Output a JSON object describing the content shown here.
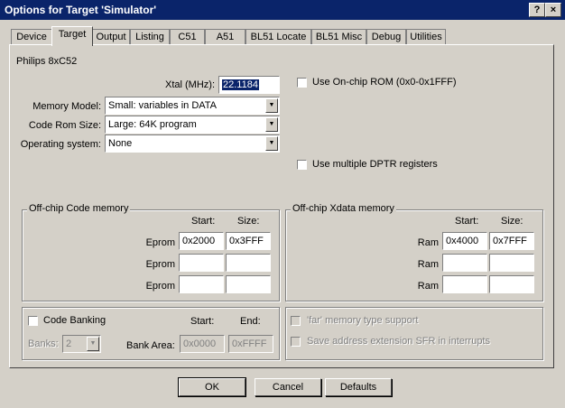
{
  "window": {
    "title": "Options for Target 'Simulator'",
    "help": "?",
    "close": "×"
  },
  "tabs": [
    "Device",
    "Target",
    "Output",
    "Listing",
    "C51",
    "A51",
    "BL51 Locate",
    "BL51 Misc",
    "Debug",
    "Utilities"
  ],
  "device_name": "Philips 8xC52",
  "xtal": {
    "label": "Xtal (MHz):",
    "value": "22.1184"
  },
  "memory_model": {
    "label": "Memory Model:",
    "value": "Small: variables in DATA"
  },
  "code_rom_size": {
    "label": "Code Rom Size:",
    "value": "Large: 64K program"
  },
  "operating_system": {
    "label": "Operating system:",
    "value": "None"
  },
  "use_onchip_rom": {
    "label": "Use On-chip ROM (0x0-0x1FFF)",
    "checked": false
  },
  "use_multiple_dptr": {
    "label": "Use multiple DPTR registers",
    "checked": false
  },
  "offchip_code": {
    "title": "Off-chip Code memory",
    "start_header": "Start:",
    "size_header": "Size:",
    "rows": [
      {
        "label": "Eprom",
        "start": "0x2000",
        "size": "0x3FFF"
      },
      {
        "label": "Eprom",
        "start": "",
        "size": ""
      },
      {
        "label": "Eprom",
        "start": "",
        "size": ""
      }
    ]
  },
  "offchip_xdata": {
    "title": "Off-chip Xdata memory",
    "start_header": "Start:",
    "size_header": "Size:",
    "rows": [
      {
        "label": "Ram",
        "start": "0x4000",
        "size": "0x7FFF"
      },
      {
        "label": "Ram",
        "start": "",
        "size": ""
      },
      {
        "label": "Ram",
        "start": "",
        "size": ""
      }
    ]
  },
  "code_banking": {
    "label": "Code Banking",
    "checked": false,
    "banks_label": "Banks:",
    "banks_value": "2",
    "start_header": "Start:",
    "end_header": "End:",
    "bank_area_label": "Bank Area:",
    "bank_area_start": "0x0000",
    "bank_area_end": "0xFFFF"
  },
  "far_memory": {
    "label": "'far' memory type support",
    "checked": false
  },
  "save_address_ext": {
    "label": "Save address extension SFR in interrupts",
    "checked": false
  },
  "buttons": {
    "ok": "OK",
    "cancel": "Cancel",
    "defaults": "Defaults"
  }
}
